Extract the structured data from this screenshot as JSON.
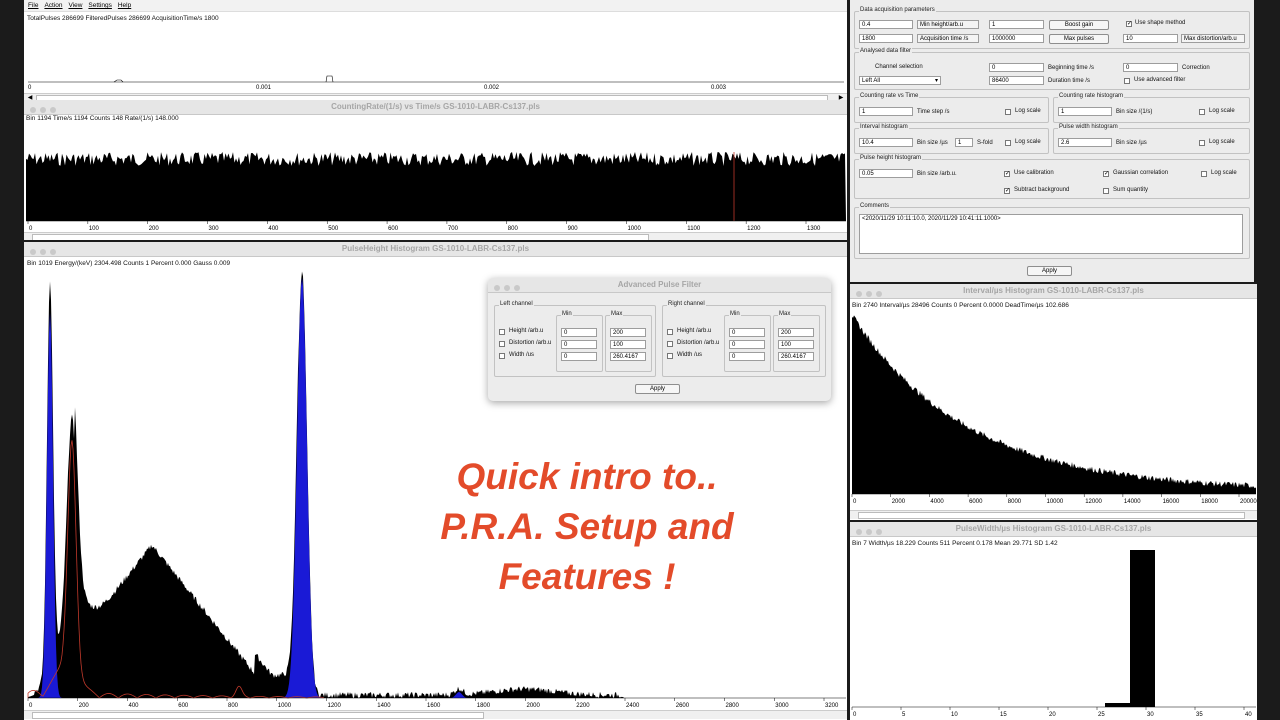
{
  "pulses_window": {
    "menu": [
      "File",
      "Action",
      "View",
      "Settings",
      "Help"
    ],
    "info": "TotalPulses 286699  FilteredPulses 286699  AcquisitionTime/s 1800",
    "ticks": [
      "0",
      "0.001",
      "0.002",
      "0.003"
    ]
  },
  "rate_window": {
    "title": "CountingRate/(1/s) vs Time/s   GS-1010-LABR-Cs137.pls",
    "info": "Bin 1194  Time/s 1194  Counts 148  Rate/(1/s) 148.000",
    "ticks": [
      "0",
      "100",
      "200",
      "300",
      "400",
      "500",
      "600",
      "700",
      "800",
      "900",
      "1000",
      "1100",
      "1200",
      "1300"
    ]
  },
  "pulse_height_window": {
    "title": "PulseHeight Histogram   GS-1010-LABR-Cs137.pls",
    "info": "Bin 1019  Energy/(keV) 2304.498  Counts 1  Percent 0.000  Gauss 0.009",
    "ticks": [
      "0",
      "200",
      "400",
      "600",
      "800",
      "1000",
      "1200",
      "1400",
      "1600",
      "1800",
      "2000",
      "2200",
      "2400",
      "2600",
      "2800",
      "3000",
      "3200"
    ]
  },
  "filter_dialog": {
    "title": "Advanced Pulse Filter",
    "left_label": "Left channel",
    "right_label": "Right channel",
    "min_label": "Min",
    "max_label": "Max",
    "rows": [
      "Height /arb.u",
      "Distortion /arb.u",
      "Width /us"
    ],
    "min_values": [
      "0",
      "0",
      "0"
    ],
    "max_values": [
      "200",
      "100",
      "260.4167"
    ],
    "apply": "Apply"
  },
  "settings_panel": {
    "acq_label": "Data acquisition parameters",
    "min_height_value": "0.4",
    "min_height_label": "Min height/arb.u",
    "boost_value": "1",
    "boost_button": "Boost gain",
    "shape_label": "Use shape method",
    "acq_time_value": "1800",
    "acq_time_label": "Acquisition time /s",
    "max_pulses_value": "1000000",
    "max_pulses_button": "Max pulses",
    "max_dist_value": "10",
    "max_dist_label": "Max distortion/arb.u",
    "filter_label": "Analysed data filter",
    "channel_label": "Channel selection",
    "channel_value": "Left All",
    "begin_value": "0",
    "begin_label": "Beginning time /s",
    "correction_value": "0",
    "correction_label": "Correction",
    "duration_value": "86400",
    "duration_label": "Duration time /s",
    "adv_filter_label": "Use advanced filter",
    "crt_label": "Counting rate vs Time",
    "time_step_value": "1",
    "time_step_label": "Time step /s",
    "crh_label": "Counting rate histogram",
    "crh_value": "1",
    "crh_bin_label": "Bin size  /(1/s)",
    "log_label": "Log scale",
    "ih_label": "Interval histogram",
    "ih_value": "10.4",
    "ih_bin_label": "Bin size /µs",
    "sfold_value": "1",
    "sfold_label": "S-fold",
    "pw_label": "Pulse width histogram",
    "pw_value": "2.6",
    "pw_bin_label": "Bin size /µs",
    "ph_label": "Pulse height histogram",
    "ph_value": "0.05",
    "ph_bin_label": "Bin size /arb.u.",
    "calib_label": "Use calibration",
    "gauss_label": "Gaussian correlation",
    "subtract_label": "Subtract background",
    "sum_label": "Sum quantity",
    "comments_label": "Comments",
    "comments_value": "<2020/11/29 10:11:10.0, 2020/11/29 10:41:11.1000>",
    "apply": "Apply"
  },
  "interval_window": {
    "title": "Interval/µs Histogram   GS-1010-LABR-Cs137.pls",
    "info": "Bin 2740  Interval/µs 28496  Counts 0  Percent 0.0000  DeadTime/µs 102.686",
    "ticks": [
      "0",
      "2000",
      "4000",
      "6000",
      "8000",
      "10000",
      "12000",
      "14000",
      "16000",
      "18000",
      "20000"
    ]
  },
  "width_window": {
    "title": "PulseWidth/µs Histogram   GS-1010-LABR-Cs137.pls",
    "info": "Bin 7  Width/µs 18.229  Counts 511  Percent 0.178  Mean 29.771  SD 1.42",
    "ticks": [
      "0",
      "5",
      "10",
      "15",
      "20",
      "25",
      "30",
      "35",
      "40"
    ]
  },
  "overlay_text": [
    "Quick intro to..",
    "P.R.A. Setup and",
    "Features !"
  ],
  "colors": {
    "peak_blue": "#1a1ad6",
    "fit_red": "#c0392b",
    "overlay": "#e34b2a"
  }
}
